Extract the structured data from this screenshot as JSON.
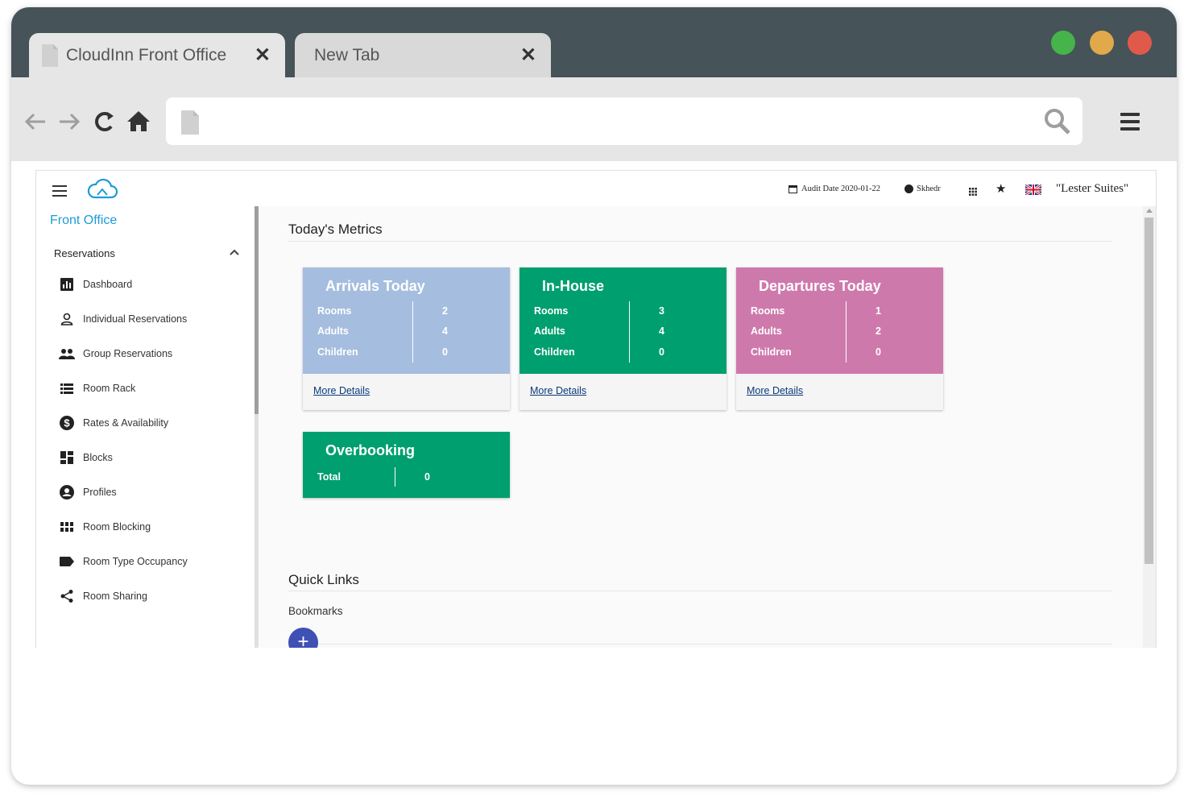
{
  "browser": {
    "tabs": [
      {
        "label": "CloudInn Front Office",
        "active": true
      },
      {
        "label": "New Tab",
        "active": false
      }
    ],
    "window_controls": [
      "#47b34b",
      "#e1a94a",
      "#e05a4c"
    ],
    "url": ""
  },
  "appbar": {
    "audit_date": "Audit Date 2020-01-22",
    "user": "Skhedr",
    "property": "\"Lester Suites\""
  },
  "sidebar": {
    "brand": "Front Office",
    "section": "Reservations",
    "items": [
      {
        "label": "Dashboard",
        "icon": "bar-chart-icon"
      },
      {
        "label": "Individual Reservations",
        "icon": "person-icon"
      },
      {
        "label": "Group Reservations",
        "icon": "people-icon"
      },
      {
        "label": "Room Rack",
        "icon": "list-icon"
      },
      {
        "label": "Rates & Availability",
        "icon": "dollar-icon"
      },
      {
        "label": "Blocks",
        "icon": "dashboard-icon"
      },
      {
        "label": "Profiles",
        "icon": "account-circle-icon"
      },
      {
        "label": "Room Blocking",
        "icon": "grid-icon"
      },
      {
        "label": "Room Type Occupancy",
        "icon": "label-icon"
      },
      {
        "label": "Room Sharing",
        "icon": "share-icon"
      }
    ]
  },
  "main": {
    "metrics_title": "Today's Metrics",
    "cards": [
      {
        "title": "Arrivals Today",
        "color": "#a5bddf",
        "rows": [
          {
            "label": "Rooms",
            "value": "2"
          },
          {
            "label": "Adults",
            "value": "4"
          },
          {
            "label": "Children",
            "value": "0"
          }
        ],
        "link": "More Details"
      },
      {
        "title": "In-House",
        "color": "#009f6f",
        "rows": [
          {
            "label": "Rooms",
            "value": "3"
          },
          {
            "label": "Adults",
            "value": "4"
          },
          {
            "label": "Children",
            "value": "0"
          }
        ],
        "link": "More Details"
      },
      {
        "title": "Departures Today",
        "color": "#ce79ac",
        "rows": [
          {
            "label": "Rooms",
            "value": "1"
          },
          {
            "label": "Adults",
            "value": "2"
          },
          {
            "label": "Children",
            "value": "0"
          }
        ],
        "link": "More Details"
      }
    ],
    "overbooking": {
      "title": "Overbooking",
      "label": "Total",
      "value": "0",
      "color": "#009f6f"
    },
    "quick_links_title": "Quick Links",
    "bookmarks_label": "Bookmarks",
    "add_label": "+"
  }
}
